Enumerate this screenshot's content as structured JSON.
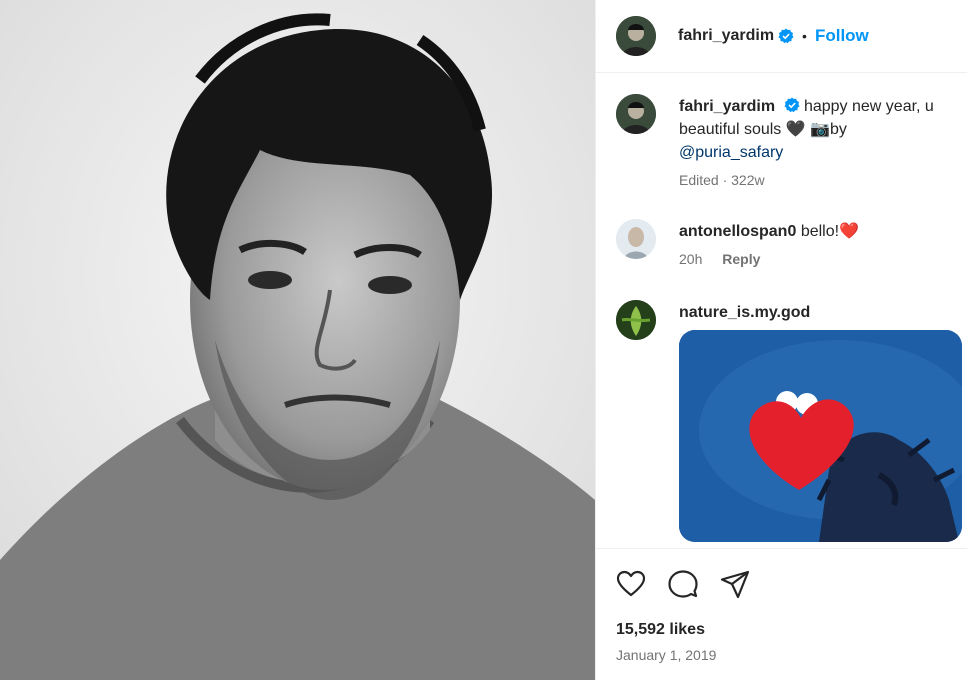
{
  "post": {
    "author": "fahri_yardim",
    "dot": "•",
    "follow_label": "Follow",
    "caption_author": "fahri_yardim",
    "caption_text": "happy new year, u beautiful souls 🖤 📷by",
    "caption_mention": "@puria_safary",
    "caption_meta": "Edited · 322w"
  },
  "comments": [
    {
      "user": "antonellospan0",
      "text": "bello!❤️",
      "time": "20h",
      "reply_label": "Reply"
    },
    {
      "user": "nature_is.my.god",
      "text": ""
    }
  ],
  "engagement": {
    "likes": "15,592 likes",
    "date": "January 1, 2019"
  },
  "colors": {
    "accent": "#0095f6",
    "verified": "#0095f6",
    "text": "#262626",
    "muted": "#737373"
  },
  "icons": [
    "heart-icon",
    "comment-icon",
    "share-icon",
    "verified-icon"
  ]
}
